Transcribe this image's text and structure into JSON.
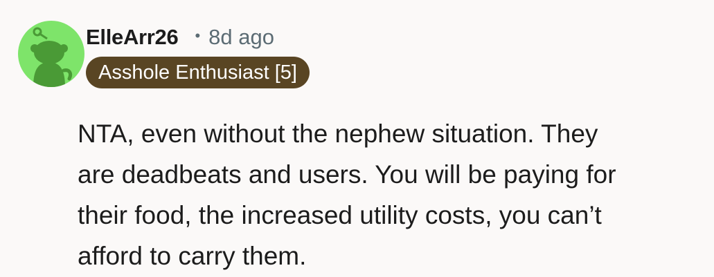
{
  "comment": {
    "author": "ElleArr26",
    "separator": "•",
    "timestamp": "8d ago",
    "flair": "Asshole Enthusiast [5]",
    "avatar_icon": "reddit-snoo-avatar-icon",
    "body_lines": [
      "NTA, even without the nephew situation. They",
      "are deadbeats and users. You will be paying for",
      "their food, the increased utility costs, you can’t",
      "afford to carry them."
    ]
  },
  "colors": {
    "background": "#fbf9f8",
    "avatar_bg": "#7ee46a",
    "avatar_figure": "#4a9a36",
    "flair_bg": "#594523",
    "flair_text": "#ffffff",
    "meta_text": "#5c6c74",
    "body_text": "#1c1c1c"
  }
}
